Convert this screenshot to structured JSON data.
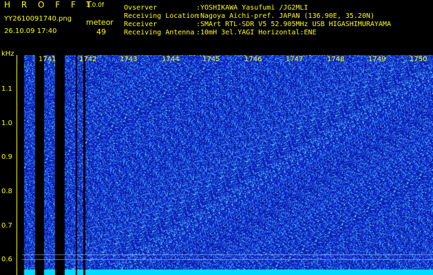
{
  "header": {
    "brand": "H R O F F T",
    "version": "1.0.0f",
    "filename": "YY2610091740.png",
    "datetime": "26.10.09 17:40",
    "mode": "meteor",
    "count": "49"
  },
  "info": [
    {
      "key": "Ovserver",
      "value": ":YOSHIKAWA Yasufumi /JG2MLI"
    },
    {
      "key": "Receiving Location",
      "value": ":Nagoya Aichi-pref. JAPAN (136.90E, 35.20N)"
    },
    {
      "key": "Receiver",
      "value": ":SMArt RTL-SDR V5 52.905MHz USB HIGASHIMURAYAMA"
    },
    {
      "key": "Receiving Antenna",
      "value": ":10mH 3el.YAGI Horizontal:ENE"
    }
  ],
  "axis": {
    "y_unit": "kHz",
    "y_ticks": [
      "1.1",
      "1.0",
      "0.9",
      "0.8",
      "0.7",
      "0.6"
    ],
    "x_ticks": [
      "1741",
      "1742",
      "1743",
      "1744",
      "1745",
      "1746",
      "1747",
      "1748",
      "1749",
      "1750"
    ]
  },
  "colors": {
    "text": "#ffff00",
    "noise_dark": "#0a1aa0",
    "noise_mid": "#2a5cff",
    "noise_light": "#4fd0ff",
    "baseline": "#00e5ff"
  }
}
